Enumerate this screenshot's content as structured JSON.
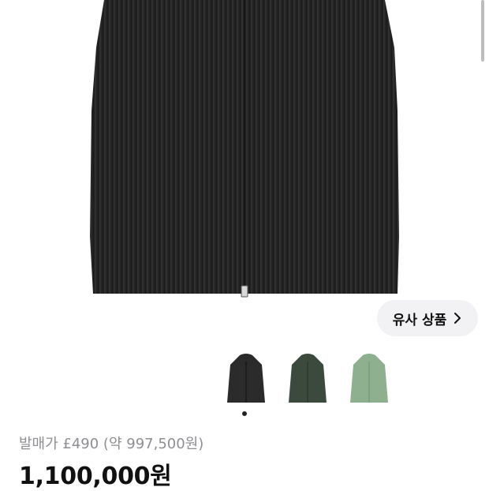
{
  "product": {
    "image_alt": "black pleated zip jacket",
    "similar_button_label": "유사 상품",
    "original_price_text": "발매가 £490 (약 997,500원)",
    "price_text": "1,100,000원"
  },
  "color_options": [
    {
      "name": "black",
      "hex": "#2b2b2b"
    },
    {
      "name": "dark-green",
      "hex": "#3b4a3d"
    },
    {
      "name": "sage-green",
      "hex": "#8fb08f"
    }
  ],
  "carousel": {
    "active_index": 0
  },
  "colors": {
    "jacket": "#262626",
    "background": "#ffffff",
    "pill": "#f2f2f4"
  }
}
